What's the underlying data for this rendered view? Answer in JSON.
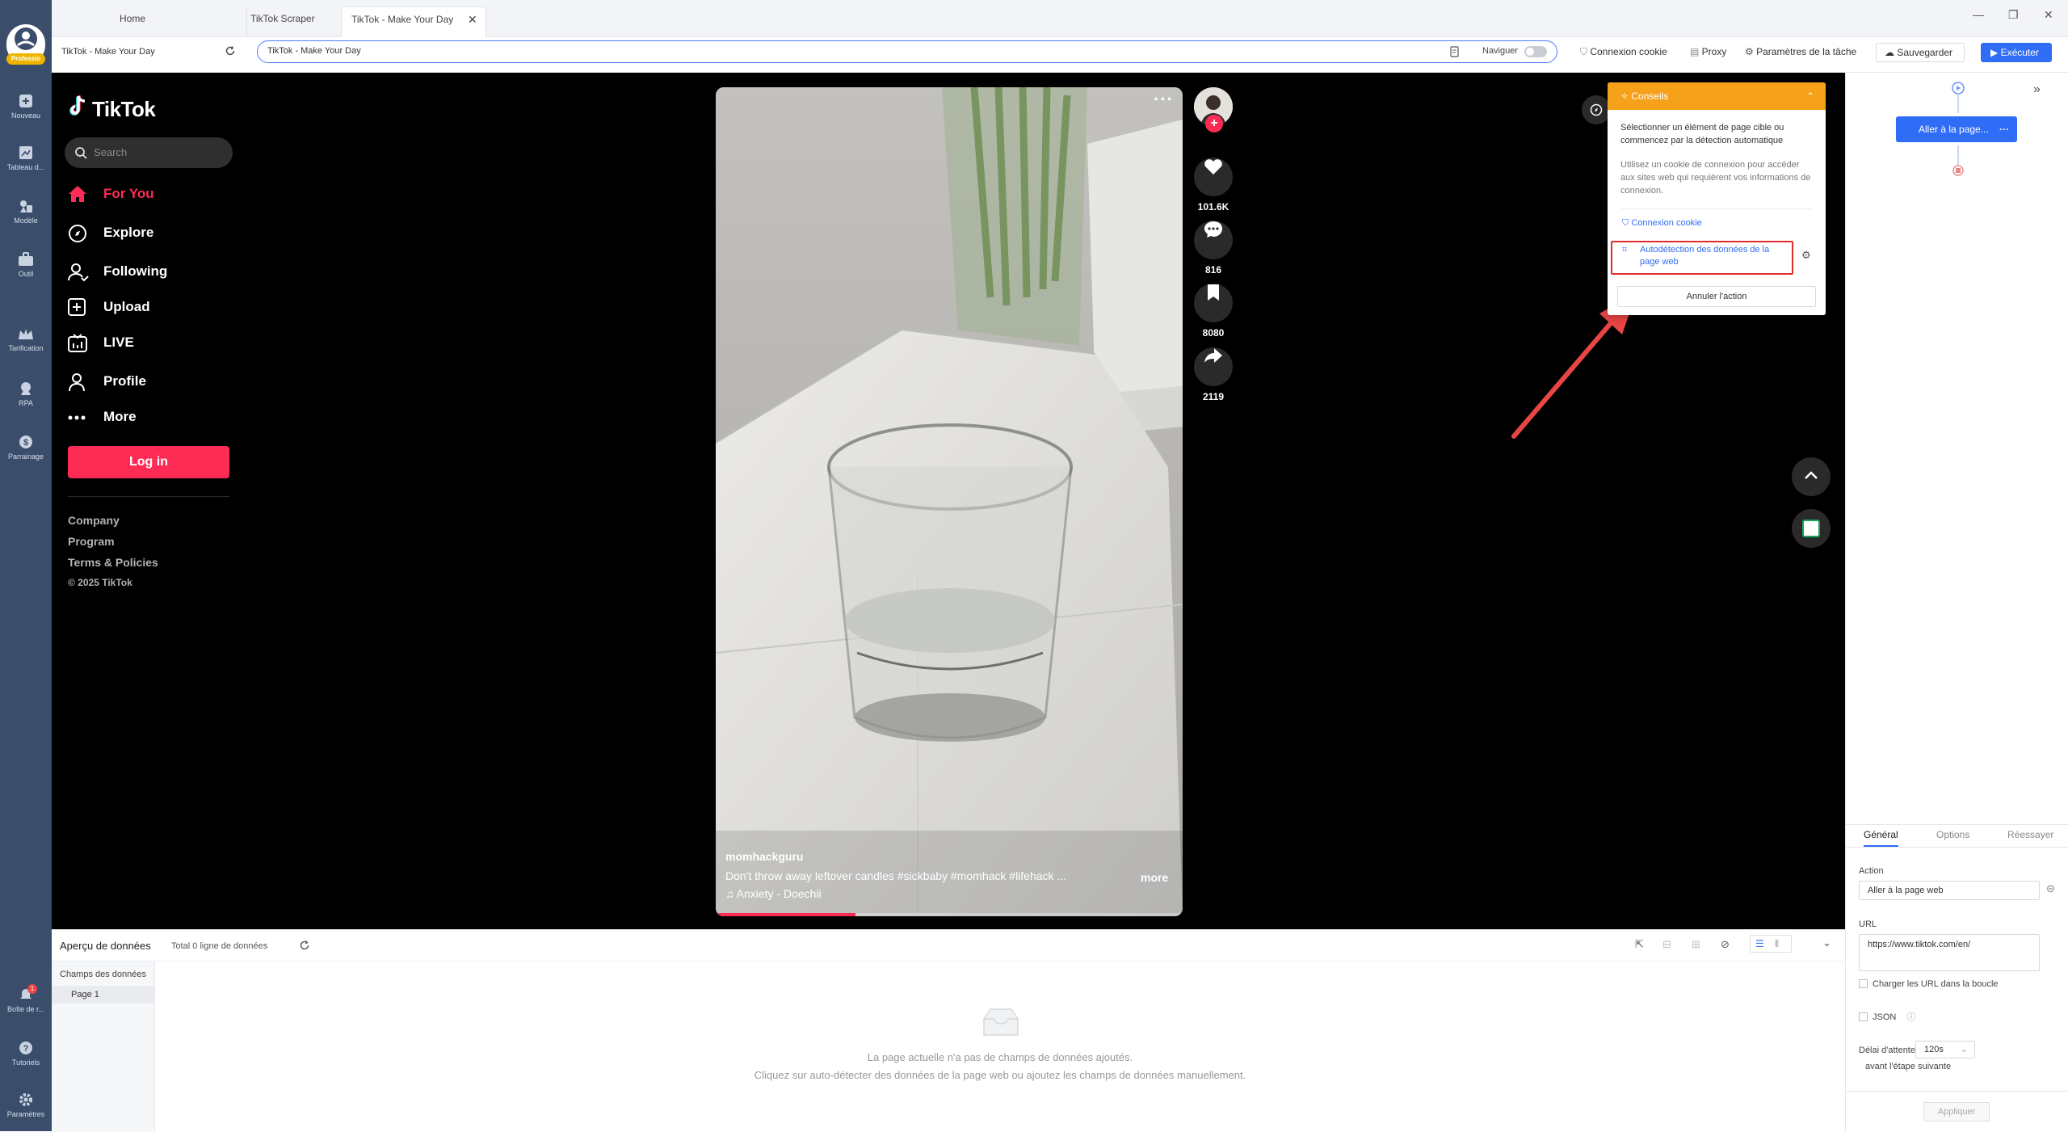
{
  "rail": {
    "badge": "Professio",
    "items": [
      {
        "label": "Nouveau",
        "icon": "plus-square-icon"
      },
      {
        "label": "Tableau d...",
        "icon": "dashboard-icon"
      },
      {
        "label": "Modèle",
        "icon": "template-icon"
      },
      {
        "label": "Outil",
        "icon": "toolbox-icon"
      },
      {
        "label": "Tarification",
        "icon": "crown-icon"
      },
      {
        "label": "RPA",
        "icon": "robot-icon"
      },
      {
        "label": "Parrainage",
        "icon": "dollar-icon"
      },
      {
        "label": "Boîte de r...",
        "icon": "bell-icon",
        "badge": "1"
      },
      {
        "label": "Tutoriels",
        "icon": "help-icon"
      },
      {
        "label": "Paramètres",
        "icon": "gear-icon"
      }
    ]
  },
  "tabs": [
    {
      "label": "Home"
    },
    {
      "label": "TikTok Scraper"
    },
    {
      "label": "TikTok - Make Your Day",
      "active": true
    }
  ],
  "toolbar": {
    "page_title": "TikTok - Make Your Day",
    "url_value": "TikTok - Make Your Day",
    "browse_label": "Naviguer",
    "cookie_label": "Connexion cookie",
    "proxy_label": "Proxy",
    "settings_label": "Paramètres de la tâche",
    "save_label": "Sauvegarder",
    "run_label": "Exécuter"
  },
  "tiktok": {
    "logo": "TikTok",
    "search_placeholder": "Search",
    "nav": [
      {
        "label": "For You",
        "icon": "home-icon",
        "active": true
      },
      {
        "label": "Explore",
        "icon": "compass-icon"
      },
      {
        "label": "Following",
        "icon": "following-icon"
      },
      {
        "label": "Upload",
        "icon": "upload-icon"
      },
      {
        "label": "LIVE",
        "icon": "live-icon"
      },
      {
        "label": "Profile",
        "icon": "profile-icon"
      },
      {
        "label": "More",
        "icon": "more-icon"
      }
    ],
    "login_label": "Log in",
    "footer": [
      "Company",
      "Program",
      "Terms & Policies"
    ],
    "copyright": "© 2025 TikTok",
    "video": {
      "author": "momhackguru",
      "caption": "Don't throw away leftover candles #sickbaby #momhack #lifehack ...",
      "more": "more",
      "music": "Anxiety - Doechii",
      "likes": "101.6K",
      "comments": "816",
      "saves": "8080",
      "shares": "2119",
      "progress": 0.3
    }
  },
  "tips": {
    "title": "Conseils",
    "text1": "Sélectionner un élément de page cible ou commencez par la détection automatique",
    "text2": "Utilisez un cookie de connexion pour accéder aux sites web qui requièrent vos informations de connexion.",
    "link_cookie": "Connexion cookie",
    "link_autodetect": "Autodétection des données de la page web",
    "cancel": "Annuler l'action"
  },
  "workflow": {
    "node_label": "Aller à la page..."
  },
  "rpanel": {
    "tabs": [
      "Général",
      "Options",
      "Réessayer"
    ],
    "action_label": "Action",
    "action_value": "Aller à la page web",
    "url_label": "URL",
    "url_value": "https://www.tiktok.com/en/",
    "loop_label": "Charger les URL dans la boucle",
    "json_label": "JSON",
    "wait_label": "Délai d'attente",
    "wait_value": "120s",
    "wait_suffix": "avant l'étape suivante",
    "apply_label": "Appliquer"
  },
  "dpanel": {
    "title": "Aperçu de données",
    "total": "Total 0 ligne de données",
    "fields_label": "Champs des données",
    "page_label": "Page 1",
    "empty1": "La page actuelle n'a pas de champs de données ajoutés.",
    "empty2": "Cliquez sur auto-détecter des données de la page web ou ajoutez les champs de données manuellement."
  }
}
